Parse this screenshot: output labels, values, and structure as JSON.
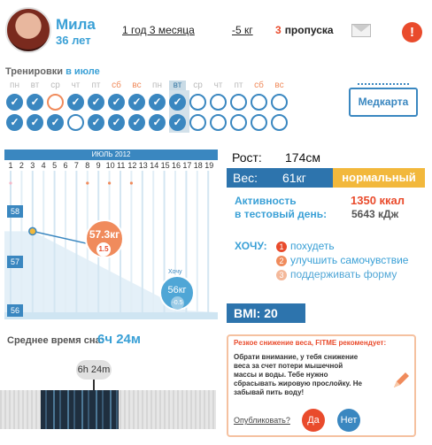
{
  "profile": {
    "name": "Мила",
    "age": "36 лет"
  },
  "stats": {
    "period": "1 год 3 месяца",
    "weight_change": "-5 кг",
    "skips_count": "3",
    "skips_label": "пропуска",
    "alert": "!"
  },
  "trainings": {
    "title": "Тренировки",
    "month": "в июле",
    "days": [
      {
        "l": "пн",
        "we": false,
        "s": "done"
      },
      {
        "l": "вт",
        "we": false,
        "s": "done"
      },
      {
        "l": "ср",
        "we": false,
        "s": "miss"
      },
      {
        "l": "чт",
        "we": false,
        "s": "done"
      },
      {
        "l": "пт",
        "we": false,
        "s": "done"
      },
      {
        "l": "сб",
        "we": true,
        "s": "done"
      },
      {
        "l": "вс",
        "we": true,
        "s": "done"
      },
      {
        "l": "пн",
        "we": false,
        "s": "done"
      },
      {
        "l": "вт",
        "we": false,
        "s": "done",
        "hl": true
      },
      {
        "l": "ср",
        "we": false,
        "s": "empty"
      },
      {
        "l": "чт",
        "we": false,
        "s": "empty"
      },
      {
        "l": "пт",
        "we": false,
        "s": "empty"
      },
      {
        "l": "сб",
        "we": true,
        "s": "empty"
      },
      {
        "l": "вс",
        "we": true,
        "s": "empty"
      }
    ],
    "row2": [
      "done",
      "done",
      "done",
      "empty",
      "done",
      "done",
      "done",
      "done",
      "done",
      "empty",
      "empty",
      "empty",
      "empty",
      "empty"
    ],
    "check": "✓",
    "medcard": "Медкарта"
  },
  "chart": {
    "header": "ИЮЛЬ 2012",
    "days": [
      "1",
      "2",
      "3",
      "4",
      "5",
      "6",
      "7",
      "8",
      "9",
      "10",
      "11",
      "12",
      "13",
      "14",
      "15",
      "16",
      "17",
      "18",
      "19"
    ],
    "y_labels": [
      "58",
      "57",
      "56"
    ],
    "point_value": "57.3кг",
    "point_sub": "1.5",
    "goal_caption": "Хочу",
    "goal_value": "56кг",
    "goal_sub": "-0.5"
  },
  "chart_data": {
    "type": "line",
    "x": [
      3,
      9
    ],
    "y": [
      57.6,
      57.3
    ],
    "ylim": [
      56,
      58
    ],
    "goal": {
      "x": 17,
      "y": 56
    }
  },
  "params": {
    "height_label": "Рост:",
    "height_value": "174см",
    "weight_label": "Вес:",
    "weight_value": "61кг",
    "weight_status": "нормальный",
    "activity_l1": "Активность",
    "activity_l2": "в тестовый день:",
    "kcal": "1350 ккал",
    "kdj": "5643 кДж"
  },
  "wants": {
    "title": "ХОЧУ:",
    "items": [
      {
        "n": "1",
        "t": "похудеть"
      },
      {
        "n": "2",
        "t": "улучшить самочувствие"
      },
      {
        "n": "3",
        "t": "поддерживать форму"
      }
    ]
  },
  "bmi": "BMI: 20",
  "sleep": {
    "label": "Среднее время сна:",
    "value": "6ч 24м",
    "tooltip": "6h 24m"
  },
  "advice": {
    "title": "Резкое снижение веса, FITME рекомендует:",
    "body": "Обрати внимание, у тебя снижение веса за счет потери мышечной массы и воды. Тебе нужно сбрасывать жировую прослойку. Не забывай пить воду!",
    "question": "Опубликовать?",
    "yes": "Да",
    "no": "Нет"
  },
  "colors": {
    "accent": "#3a87c0",
    "orange": "#f08b5c",
    "red": "#e94b2c",
    "yellow": "#f2b83c"
  }
}
